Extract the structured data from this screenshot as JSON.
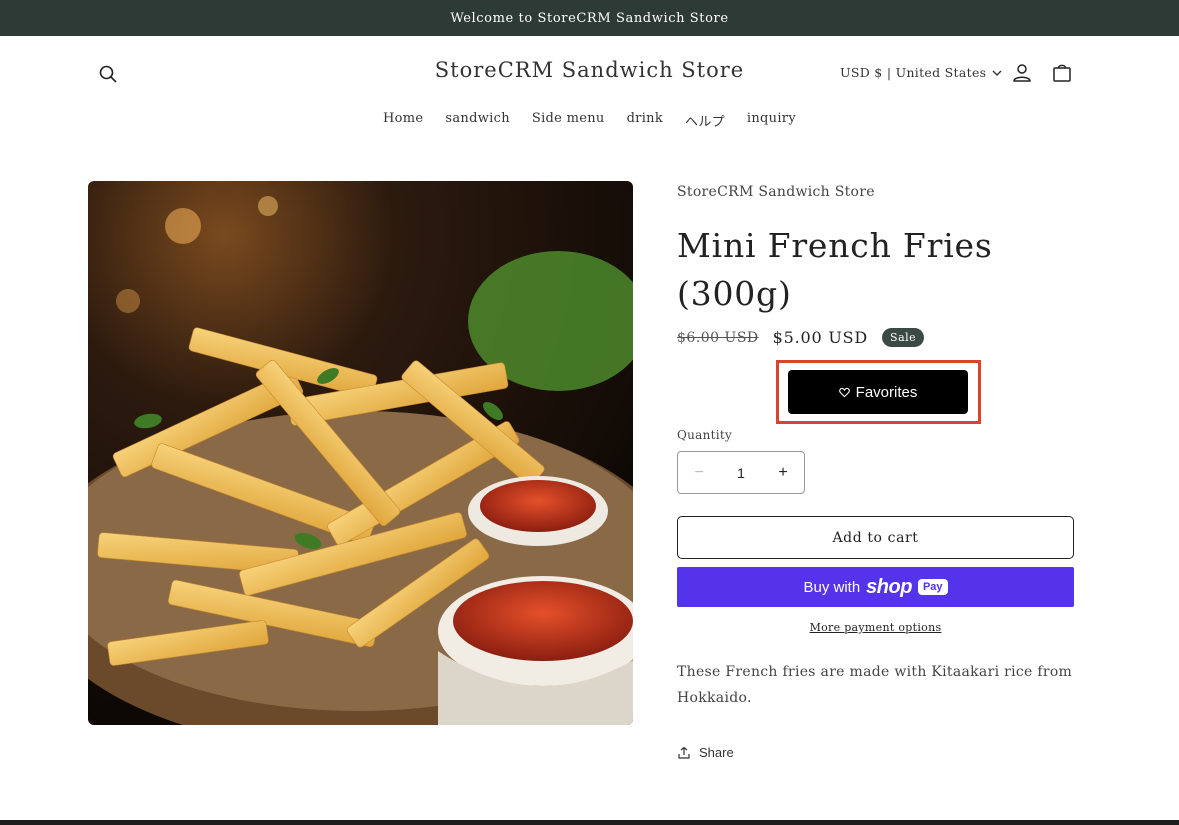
{
  "announcement": {
    "text": "Welcome to StoreCRM Sandwich Store"
  },
  "header": {
    "store_name": "StoreCRM Sandwich Store",
    "currency_label": "USD $ | United States",
    "icons": {
      "search": "search-icon",
      "account": "user-icon",
      "cart": "bag-icon",
      "currency_chevron": "chevron-down-icon"
    }
  },
  "nav": {
    "items": [
      {
        "label": "Home"
      },
      {
        "label": "sandwich"
      },
      {
        "label": "Side menu"
      },
      {
        "label": "drink"
      },
      {
        "label": "ヘルプ"
      },
      {
        "label": "inquiry"
      }
    ]
  },
  "product": {
    "vendor": "StoreCRM Sandwich Store",
    "title": "Mini French Fries (300g)",
    "price_old": "$6.00 USD",
    "price_new": "$5.00 USD",
    "badge": "Sale",
    "favorites_label": "Favorites",
    "quantity_label": "Quantity",
    "quantity_value": "1",
    "qty_minus": "−",
    "qty_plus": "+",
    "add_to_cart": "Add to cart",
    "buy_with": "Buy with",
    "shop_brand": "shop",
    "pay_brand": "Pay",
    "more_payment": "More payment options",
    "description": "These French fries are made with Kitaakari rice from Hokkaido.",
    "share_label": "Share"
  },
  "colors": {
    "announcement_bg": "#2d3a35",
    "sale_badge": "#3b4a45",
    "shop_pay": "#5433eb",
    "highlight_frame": "#d9442e"
  }
}
